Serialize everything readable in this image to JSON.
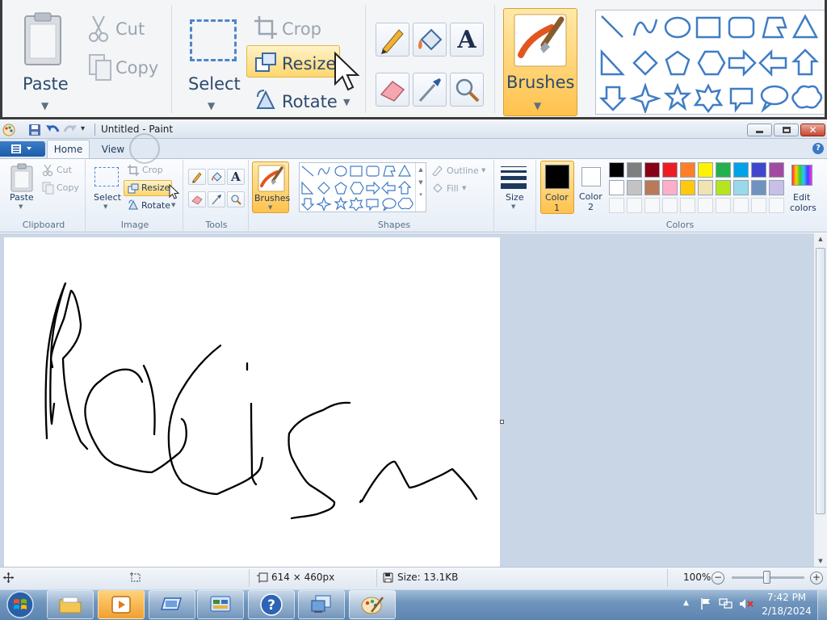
{
  "zoom_inset": {
    "paste": "Paste",
    "cut": "Cut",
    "copy": "Copy",
    "select": "Select",
    "crop": "Crop",
    "resize": "Resize",
    "rotate": "Rotate",
    "brushes": "Brushes"
  },
  "window": {
    "title": "Untitled - Paint"
  },
  "tabs": {
    "home": "Home",
    "view": "View"
  },
  "ribbon": {
    "clipboard": {
      "paste": "Paste",
      "cut": "Cut",
      "copy": "Copy",
      "label": "Clipboard"
    },
    "image": {
      "select": "Select",
      "crop": "Crop",
      "resize": "Resize",
      "rotate": "Rotate",
      "label": "Image"
    },
    "tools": {
      "label": "Tools"
    },
    "brushes": {
      "label": "Brushes"
    },
    "shapes": {
      "outline": "Outline",
      "fill": "Fill",
      "label": "Shapes"
    },
    "size": {
      "label": "Size"
    },
    "colors": {
      "color1_label": "Color",
      "color1_num": "1",
      "color2_label": "Color",
      "color2_num": "2",
      "edit_label": "Edit",
      "edit_label2": "colors",
      "label": "Colors",
      "color1": "#000000",
      "color2": "#ffffff",
      "row1": [
        "#000000",
        "#7f7f7f",
        "#880015",
        "#ed1c24",
        "#ff7f27",
        "#fff200",
        "#22b14c",
        "#00a2e8",
        "#3f48cc",
        "#a349a4"
      ],
      "row2": [
        "#ffffff",
        "#c3c3c3",
        "#b97a57",
        "#ffaec9",
        "#ffc90e",
        "#efe4b0",
        "#b5e61d",
        "#99d9ea",
        "#7092be",
        "#c8bfe7"
      ]
    }
  },
  "status": {
    "dimensions": "614 × 460px",
    "size": "Size: 13.1KB",
    "zoom": "100%"
  },
  "clock": {
    "time": "7:42 PM",
    "date": "2/18/2024"
  }
}
